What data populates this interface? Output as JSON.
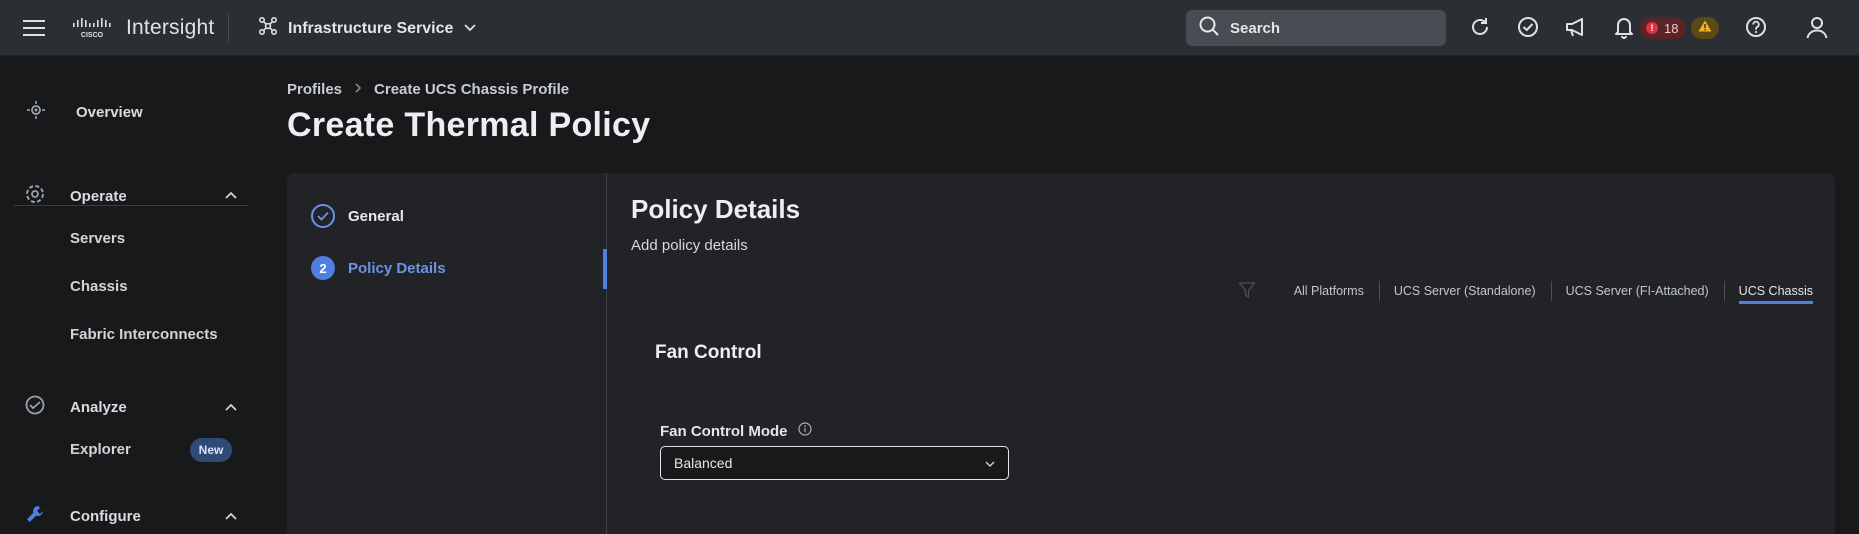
{
  "header": {
    "brand": "Intersight",
    "service": "Infrastructure Service",
    "search_placeholder": "Search",
    "critical_count": "18",
    "icons": [
      "hamburger-icon",
      "cisco-logo",
      "network-icon",
      "chevron-down-icon",
      "search-icon",
      "refresh-icon",
      "check-circle-icon",
      "megaphone-icon",
      "bell-icon",
      "warning-icon",
      "help-icon",
      "user-icon"
    ]
  },
  "sidebar": {
    "overview": "Overview",
    "operate": "Operate",
    "operate_items": [
      "Servers",
      "Chassis",
      "Fabric Interconnects"
    ],
    "analyze": "Analyze",
    "analyze_items": [
      "Explorer"
    ],
    "new_badge": "New",
    "configure": "Configure"
  },
  "breadcrumb": [
    "Profiles",
    "Create UCS Chassis Profile"
  ],
  "page_title": "Create Thermal Policy",
  "steps": [
    {
      "label": "General",
      "number": "",
      "status": "done"
    },
    {
      "label": "Policy Details",
      "number": "2",
      "status": "active"
    }
  ],
  "section": {
    "title": "Policy Details",
    "subtitle": "Add policy details"
  },
  "platform_tabs": [
    "All Platforms",
    "UCS Server (Standalone)",
    "UCS Server (FI-Attached)",
    "UCS Chassis"
  ],
  "active_platform": "UCS Chassis",
  "fan_control": {
    "title": "Fan Control",
    "mode_label": "Fan Control Mode",
    "mode_value": "Balanced"
  },
  "colors": {
    "accent": "#4f7fe0",
    "critical": "#e2323e",
    "warning": "#f0b323",
    "header_bg": "#2b2e33",
    "page_bg": "#18191b",
    "card_bg": "#212326"
  }
}
